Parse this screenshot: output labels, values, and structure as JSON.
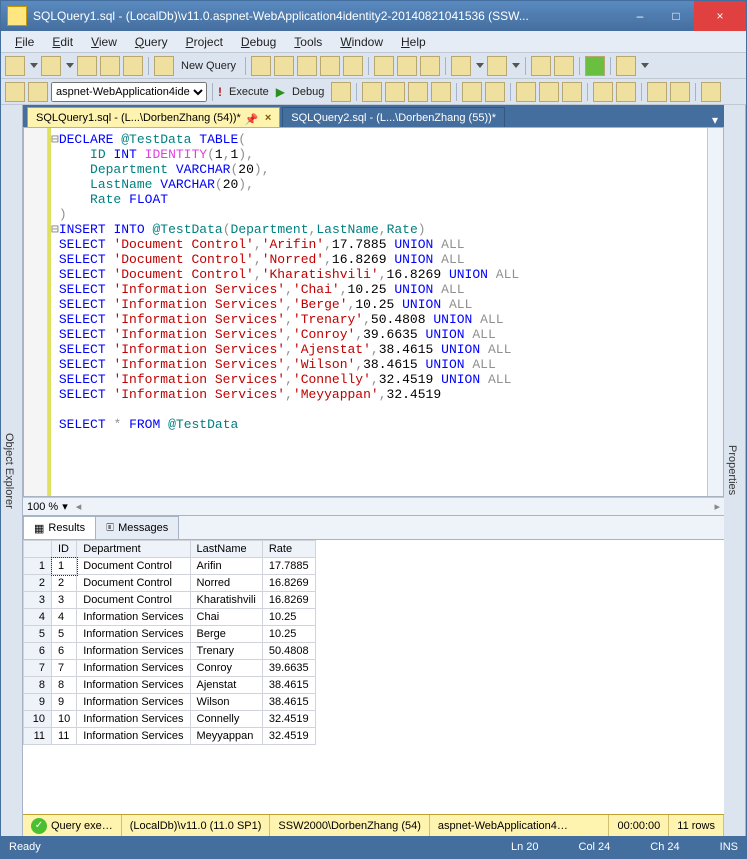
{
  "title": "SQLQuery1.sql - (LocalDb)\\v11.0.aspnet-WebApplication4identity2-20140821041536 (SSW...",
  "window_buttons": {
    "min": "–",
    "max": "□",
    "close": "×"
  },
  "menu": [
    "File",
    "Edit",
    "View",
    "Query",
    "Project",
    "Debug",
    "Tools",
    "Window",
    "Help"
  ],
  "toolbar": {
    "new_query": "New Query",
    "db_selector": "aspnet-WebApplication4ide",
    "execute": "Execute",
    "debug": "Debug"
  },
  "left_panel": "Object Explorer",
  "right_panel": "Properties",
  "tabs": [
    {
      "label": "SQLQuery1.sql - (L...\\DorbenZhang (54))*",
      "active": true
    },
    {
      "label": "SQLQuery2.sql - (L...\\DorbenZhang (55))*",
      "active": false
    }
  ],
  "code_lines": [
    [
      {
        "c": "kw",
        "t": "DECLARE"
      },
      {
        "c": "",
        "t": " "
      },
      {
        "c": "func",
        "t": "@TestData"
      },
      {
        "c": "",
        "t": " "
      },
      {
        "c": "kw",
        "t": "TABLE"
      },
      {
        "c": "grey",
        "t": "("
      }
    ],
    [
      {
        "c": "",
        "t": "    "
      },
      {
        "c": "func",
        "t": "ID"
      },
      {
        "c": "",
        "t": " "
      },
      {
        "c": "kw",
        "t": "INT"
      },
      {
        "c": "",
        "t": " "
      },
      {
        "c": "sysfn",
        "t": "IDENTITY"
      },
      {
        "c": "grey",
        "t": "("
      },
      {
        "c": "",
        "t": "1"
      },
      {
        "c": "grey",
        "t": ","
      },
      {
        "c": "",
        "t": "1"
      },
      {
        "c": "grey",
        "t": "),"
      }
    ],
    [
      {
        "c": "",
        "t": "    "
      },
      {
        "c": "func",
        "t": "Department"
      },
      {
        "c": "",
        "t": " "
      },
      {
        "c": "kw",
        "t": "VARCHAR"
      },
      {
        "c": "grey",
        "t": "("
      },
      {
        "c": "",
        "t": "20"
      },
      {
        "c": "grey",
        "t": "),"
      }
    ],
    [
      {
        "c": "",
        "t": "    "
      },
      {
        "c": "func",
        "t": "LastName"
      },
      {
        "c": "",
        "t": " "
      },
      {
        "c": "kw",
        "t": "VARCHAR"
      },
      {
        "c": "grey",
        "t": "("
      },
      {
        "c": "",
        "t": "20"
      },
      {
        "c": "grey",
        "t": "),"
      }
    ],
    [
      {
        "c": "",
        "t": "    "
      },
      {
        "c": "func",
        "t": "Rate"
      },
      {
        "c": "",
        "t": " "
      },
      {
        "c": "kw",
        "t": "FLOAT"
      }
    ],
    [
      {
        "c": "grey",
        "t": ")"
      }
    ],
    [
      {
        "c": "kw",
        "t": "INSERT"
      },
      {
        "c": "",
        "t": " "
      },
      {
        "c": "kw",
        "t": "INTO"
      },
      {
        "c": "",
        "t": " "
      },
      {
        "c": "func",
        "t": "@TestData"
      },
      {
        "c": "grey",
        "t": "("
      },
      {
        "c": "func",
        "t": "Department"
      },
      {
        "c": "grey",
        "t": ","
      },
      {
        "c": "func",
        "t": "LastName"
      },
      {
        "c": "grey",
        "t": ","
      },
      {
        "c": "func",
        "t": "Rate"
      },
      {
        "c": "grey",
        "t": ")"
      }
    ],
    [
      {
        "c": "kw",
        "t": "SELECT"
      },
      {
        "c": "",
        "t": " "
      },
      {
        "c": "str",
        "t": "'Document Control'"
      },
      {
        "c": "grey",
        "t": ","
      },
      {
        "c": "str",
        "t": "'Arifin'"
      },
      {
        "c": "grey",
        "t": ","
      },
      {
        "c": "",
        "t": "17.7885 "
      },
      {
        "c": "kw",
        "t": "UNION"
      },
      {
        "c": "",
        "t": " "
      },
      {
        "c": "grey",
        "t": "ALL"
      }
    ],
    [
      {
        "c": "kw",
        "t": "SELECT"
      },
      {
        "c": "",
        "t": " "
      },
      {
        "c": "str",
        "t": "'Document Control'"
      },
      {
        "c": "grey",
        "t": ","
      },
      {
        "c": "str",
        "t": "'Norred'"
      },
      {
        "c": "grey",
        "t": ","
      },
      {
        "c": "",
        "t": "16.8269 "
      },
      {
        "c": "kw",
        "t": "UNION"
      },
      {
        "c": "",
        "t": " "
      },
      {
        "c": "grey",
        "t": "ALL"
      }
    ],
    [
      {
        "c": "kw",
        "t": "SELECT"
      },
      {
        "c": "",
        "t": " "
      },
      {
        "c": "str",
        "t": "'Document Control'"
      },
      {
        "c": "grey",
        "t": ","
      },
      {
        "c": "str",
        "t": "'Kharatishvili'"
      },
      {
        "c": "grey",
        "t": ","
      },
      {
        "c": "",
        "t": "16.8269 "
      },
      {
        "c": "kw",
        "t": "UNION"
      },
      {
        "c": "",
        "t": " "
      },
      {
        "c": "grey",
        "t": "ALL"
      }
    ],
    [
      {
        "c": "kw",
        "t": "SELECT"
      },
      {
        "c": "",
        "t": " "
      },
      {
        "c": "str",
        "t": "'Information Services'"
      },
      {
        "c": "grey",
        "t": ","
      },
      {
        "c": "str",
        "t": "'Chai'"
      },
      {
        "c": "grey",
        "t": ","
      },
      {
        "c": "",
        "t": "10.25 "
      },
      {
        "c": "kw",
        "t": "UNION"
      },
      {
        "c": "",
        "t": " "
      },
      {
        "c": "grey",
        "t": "ALL"
      }
    ],
    [
      {
        "c": "kw",
        "t": "SELECT"
      },
      {
        "c": "",
        "t": " "
      },
      {
        "c": "str",
        "t": "'Information Services'"
      },
      {
        "c": "grey",
        "t": ","
      },
      {
        "c": "str",
        "t": "'Berge'"
      },
      {
        "c": "grey",
        "t": ","
      },
      {
        "c": "",
        "t": "10.25 "
      },
      {
        "c": "kw",
        "t": "UNION"
      },
      {
        "c": "",
        "t": " "
      },
      {
        "c": "grey",
        "t": "ALL"
      }
    ],
    [
      {
        "c": "kw",
        "t": "SELECT"
      },
      {
        "c": "",
        "t": " "
      },
      {
        "c": "str",
        "t": "'Information Services'"
      },
      {
        "c": "grey",
        "t": ","
      },
      {
        "c": "str",
        "t": "'Trenary'"
      },
      {
        "c": "grey",
        "t": ","
      },
      {
        "c": "",
        "t": "50.4808 "
      },
      {
        "c": "kw",
        "t": "UNION"
      },
      {
        "c": "",
        "t": " "
      },
      {
        "c": "grey",
        "t": "ALL"
      }
    ],
    [
      {
        "c": "kw",
        "t": "SELECT"
      },
      {
        "c": "",
        "t": " "
      },
      {
        "c": "str",
        "t": "'Information Services'"
      },
      {
        "c": "grey",
        "t": ","
      },
      {
        "c": "str",
        "t": "'Conroy'"
      },
      {
        "c": "grey",
        "t": ","
      },
      {
        "c": "",
        "t": "39.6635 "
      },
      {
        "c": "kw",
        "t": "UNION"
      },
      {
        "c": "",
        "t": " "
      },
      {
        "c": "grey",
        "t": "ALL"
      }
    ],
    [
      {
        "c": "kw",
        "t": "SELECT"
      },
      {
        "c": "",
        "t": " "
      },
      {
        "c": "str",
        "t": "'Information Services'"
      },
      {
        "c": "grey",
        "t": ","
      },
      {
        "c": "str",
        "t": "'Ajenstat'"
      },
      {
        "c": "grey",
        "t": ","
      },
      {
        "c": "",
        "t": "38.4615 "
      },
      {
        "c": "kw",
        "t": "UNION"
      },
      {
        "c": "",
        "t": " "
      },
      {
        "c": "grey",
        "t": "ALL"
      }
    ],
    [
      {
        "c": "kw",
        "t": "SELECT"
      },
      {
        "c": "",
        "t": " "
      },
      {
        "c": "str",
        "t": "'Information Services'"
      },
      {
        "c": "grey",
        "t": ","
      },
      {
        "c": "str",
        "t": "'Wilson'"
      },
      {
        "c": "grey",
        "t": ","
      },
      {
        "c": "",
        "t": "38.4615 "
      },
      {
        "c": "kw",
        "t": "UNION"
      },
      {
        "c": "",
        "t": " "
      },
      {
        "c": "grey",
        "t": "ALL"
      }
    ],
    [
      {
        "c": "kw",
        "t": "SELECT"
      },
      {
        "c": "",
        "t": " "
      },
      {
        "c": "str",
        "t": "'Information Services'"
      },
      {
        "c": "grey",
        "t": ","
      },
      {
        "c": "str",
        "t": "'Connelly'"
      },
      {
        "c": "grey",
        "t": ","
      },
      {
        "c": "",
        "t": "32.4519 "
      },
      {
        "c": "kw",
        "t": "UNION"
      },
      {
        "c": "",
        "t": " "
      },
      {
        "c": "grey",
        "t": "ALL"
      }
    ],
    [
      {
        "c": "kw",
        "t": "SELECT"
      },
      {
        "c": "",
        "t": " "
      },
      {
        "c": "str",
        "t": "'Information Services'"
      },
      {
        "c": "grey",
        "t": ","
      },
      {
        "c": "str",
        "t": "'Meyyappan'"
      },
      {
        "c": "grey",
        "t": ","
      },
      {
        "c": "",
        "t": "32.4519"
      }
    ],
    [],
    [
      {
        "c": "kw",
        "t": "SELECT"
      },
      {
        "c": "",
        "t": " "
      },
      {
        "c": "grey",
        "t": "*"
      },
      {
        "c": "",
        "t": " "
      },
      {
        "c": "kw",
        "t": "FROM"
      },
      {
        "c": "",
        "t": " "
      },
      {
        "c": "func",
        "t": "@TestData"
      }
    ]
  ],
  "zoom": "100 %",
  "results_tabs": {
    "results": "Results",
    "messages": "Messages"
  },
  "grid": {
    "headers": [
      "ID",
      "Department",
      "LastName",
      "Rate"
    ],
    "rows": [
      [
        "1",
        "Document Control",
        "Arifin",
        "17.7885"
      ],
      [
        "2",
        "Document Control",
        "Norred",
        "16.8269"
      ],
      [
        "3",
        "Document Control",
        "Kharatishvili",
        "16.8269"
      ],
      [
        "4",
        "Information Services",
        "Chai",
        "10.25"
      ],
      [
        "5",
        "Information Services",
        "Berge",
        "10.25"
      ],
      [
        "6",
        "Information Services",
        "Trenary",
        "50.4808"
      ],
      [
        "7",
        "Information Services",
        "Conroy",
        "39.6635"
      ],
      [
        "8",
        "Information Services",
        "Ajenstat",
        "38.4615"
      ],
      [
        "9",
        "Information Services",
        "Wilson",
        "38.4615"
      ],
      [
        "10",
        "Information Services",
        "Connelly",
        "32.4519"
      ],
      [
        "11",
        "Information Services",
        "Meyyappan",
        "32.4519"
      ]
    ]
  },
  "statusbar": {
    "query_state": "Query exe…",
    "server": "(LocalDb)\\v11.0 (11.0 SP1)",
    "user": "SSW2000\\DorbenZhang (54)",
    "db": "aspnet-WebApplication4…",
    "time": "00:00:00",
    "rows": "11 rows"
  },
  "readybar": {
    "ready": "Ready",
    "ln": "Ln 20",
    "col": "Col 24",
    "ch": "Ch 24",
    "ins": "INS"
  }
}
